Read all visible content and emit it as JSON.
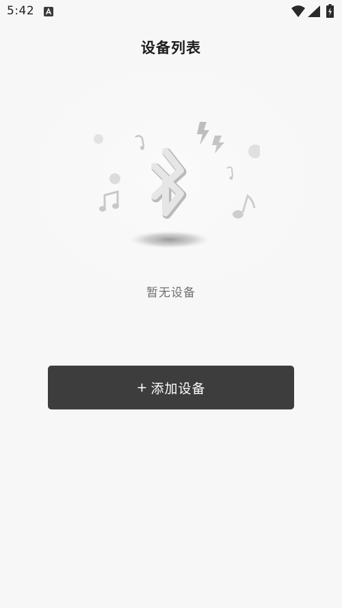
{
  "status_bar": {
    "time": "5:42",
    "icons": [
      "app-notification-icon",
      "wifi-icon",
      "signal-icon",
      "battery-charging-icon"
    ]
  },
  "header": {
    "title": "设备列表"
  },
  "empty_state": {
    "illustration": "bluetooth-music-illustration",
    "message": "暂无设备"
  },
  "actions": {
    "add_device_label": "添加设备",
    "add_device_icon": "+"
  },
  "colors": {
    "background": "#f7f7f7",
    "button": "#3d3d3d",
    "button_text": "#ffffff",
    "muted_text": "#6f6f6f",
    "title_text": "#1c1c1c"
  }
}
